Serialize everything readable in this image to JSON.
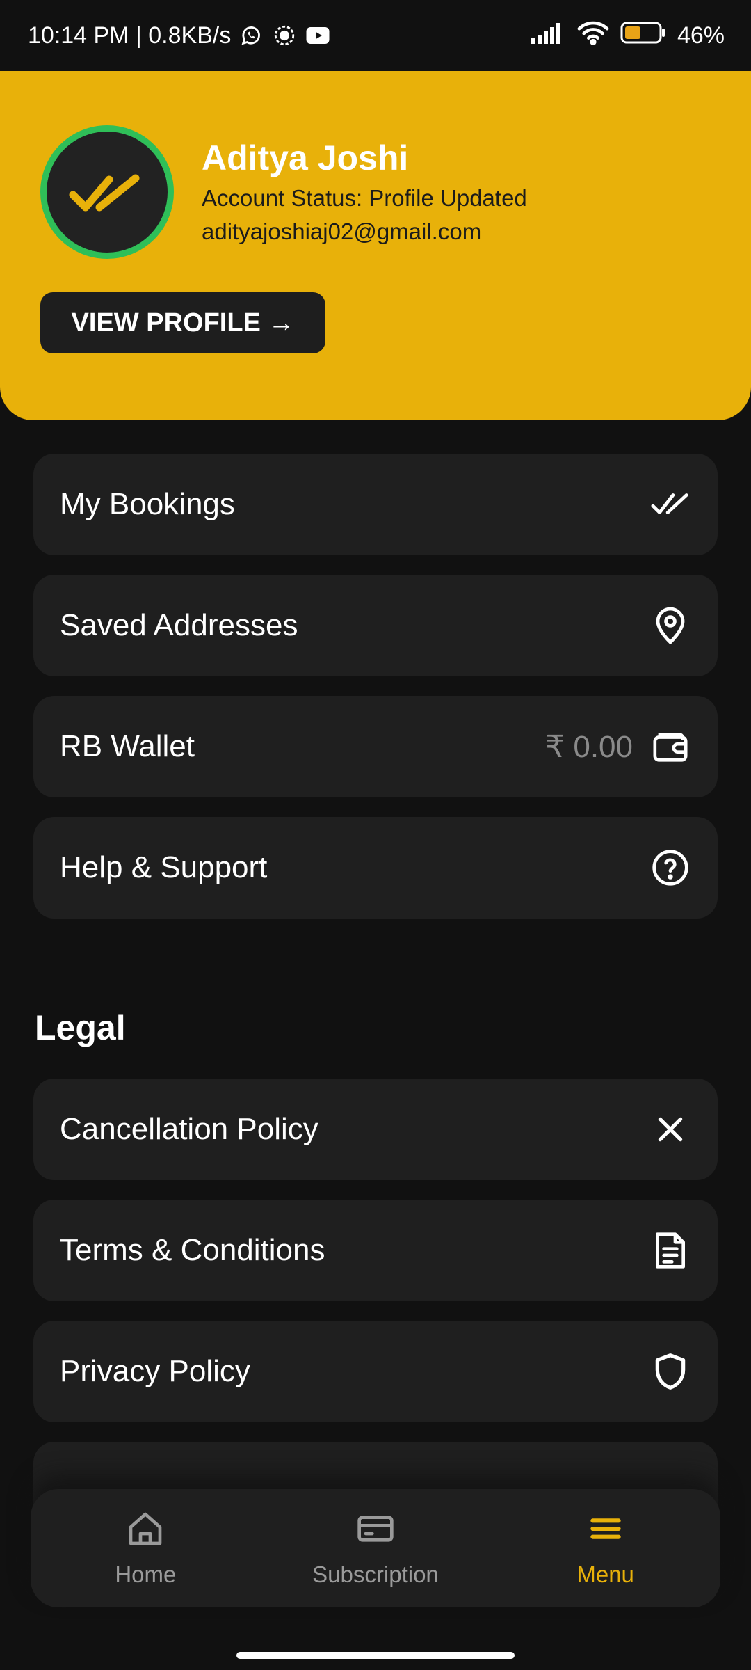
{
  "status_bar": {
    "time_network": "10:14 PM | 0.8KB/s",
    "battery": "46%",
    "icons": [
      "whatsapp-icon",
      "signal-app-icon",
      "youtube-icon",
      "cell-signal-icon",
      "wifi-icon",
      "battery-icon"
    ]
  },
  "profile": {
    "name": "Aditya Joshi",
    "status": "Account Status: Profile Updated",
    "email": "adityajoshiaj02@gmail.com",
    "view_profile_label": "VIEW PROFILE →"
  },
  "menu": {
    "bookings": {
      "label": "My Bookings",
      "icon": "double-check-icon"
    },
    "addresses": {
      "label": "Saved Addresses",
      "icon": "location-pin-icon"
    },
    "wallet": {
      "label": "RB Wallet",
      "value": "₹ 0.00",
      "icon": "wallet-icon"
    },
    "help": {
      "label": "Help & Support",
      "icon": "help-circle-icon"
    }
  },
  "legal": {
    "title": "Legal",
    "cancellation": {
      "label": "Cancellation Policy",
      "icon": "close-icon"
    },
    "terms": {
      "label": "Terms & Conditions",
      "icon": "document-icon"
    },
    "privacy": {
      "label": "Privacy Policy",
      "icon": "shield-icon"
    }
  },
  "nav": {
    "home": "Home",
    "subscription": "Subscription",
    "menu": "Menu"
  },
  "colors": {
    "accent": "#e8b10a",
    "avatar_ring": "#2fbf58",
    "background": "#111111",
    "card": "#1f1f1f"
  }
}
